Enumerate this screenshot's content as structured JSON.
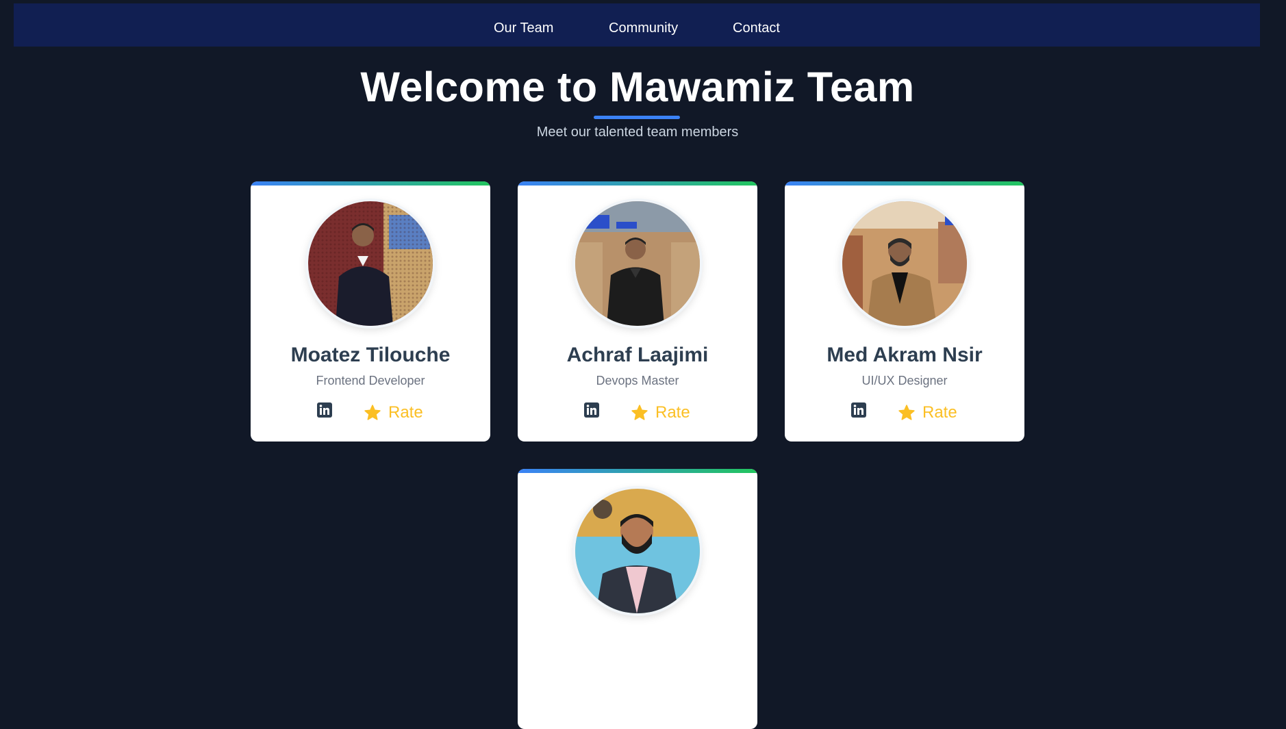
{
  "nav": {
    "links": [
      "Our Team",
      "Community",
      "Contact"
    ],
    "background": "#111f52"
  },
  "hero": {
    "title": "Welcome to Mawamiz Team",
    "subtitle": "Meet our talented team members",
    "underline_color": "#3b82f6"
  },
  "team": [
    {
      "name": "Moatez Tilouche",
      "role": "Frontend Developer",
      "rate_label": "Rate",
      "photo": "avatar-photo"
    },
    {
      "name": "Achraf Laajimi",
      "role": "Devops Master",
      "rate_label": "Rate",
      "photo": "avatar-photo"
    },
    {
      "name": "Med Akram Nsir",
      "role": "UI/UX Designer",
      "rate_label": "Rate",
      "photo": "avatar-photo"
    },
    {
      "name": "",
      "role": "",
      "rate_label": "",
      "photo": "avatar-photo"
    }
  ],
  "icons": {
    "social": "linkedin-icon",
    "rate": "star-icon"
  },
  "colors": {
    "page_background": "#111827",
    "card_accent_start": "#3b82f6",
    "card_accent_end": "#22c55e",
    "name_text": "#2d3e50",
    "rate_text": "#fbbf24"
  }
}
